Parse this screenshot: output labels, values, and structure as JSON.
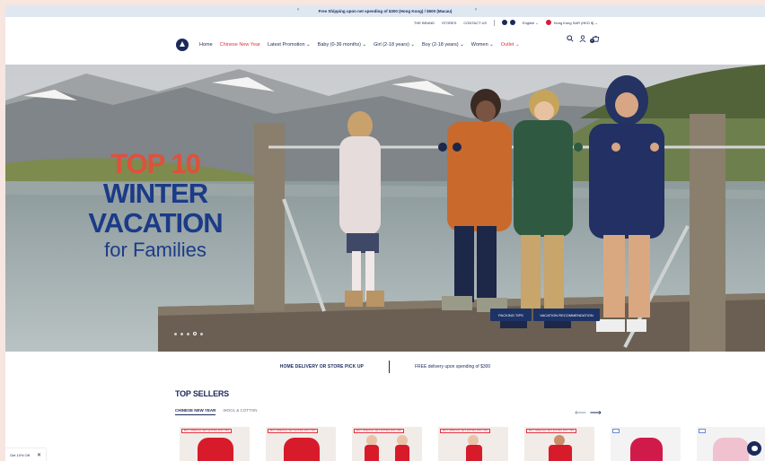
{
  "announcement": {
    "text": "Free Shipping upon net spending of $300 (Hong Kong) / $500 (Macau)",
    "prev_icon": "chevron-left-icon",
    "next_icon": "chevron-right-icon"
  },
  "utility_bar": {
    "links": [
      "THE BRAND",
      "STORES",
      "CONTACT US"
    ],
    "social_icons": [
      "facebook-icon",
      "instagram-icon"
    ],
    "language": "English",
    "region": "Hong Kong SAR (HKD $)"
  },
  "nav": {
    "logo_icon": "boat-logo-icon",
    "items": [
      {
        "label": "Home",
        "dropdown": false,
        "color": "#1b2a5a"
      },
      {
        "label": "Chinese New Year",
        "dropdown": false,
        "color": "#e03140"
      },
      {
        "label": "Latest Promotion",
        "dropdown": true,
        "color": "#1b2a5a"
      },
      {
        "label": "Baby (0-36 months)",
        "dropdown": true,
        "color": "#1b2a5a"
      },
      {
        "label": "Girl (2-18 years)",
        "dropdown": true,
        "color": "#1b2a5a"
      },
      {
        "label": "Boy (2-18 years)",
        "dropdown": true,
        "color": "#1b2a5a"
      },
      {
        "label": "Women",
        "dropdown": true,
        "color": "#1b2a5a"
      },
      {
        "label": "Outlet",
        "dropdown": true,
        "color": "#e03140"
      }
    ],
    "icons": [
      "search-icon",
      "account-icon",
      "cart-icon"
    ],
    "cart_count": "0"
  },
  "hero": {
    "headline_line1": "TOP 10",
    "headline_line2": "WINTER",
    "headline_line3": "VACATION",
    "headline_line4": "for Families",
    "buttons": [
      "PACKING TIPS",
      "VACATION RECOMMENDATION"
    ],
    "slide_count": 5,
    "active_slide": 4
  },
  "delivery": {
    "left": "HOME DELIVERY OR STORE PICK UP",
    "right": "FREE delivery upon spending of $300"
  },
  "top_sellers": {
    "title": "TOP SELLERS",
    "tabs": [
      "CHINESE NEW YEAR",
      "WOOL & COTTON"
    ],
    "active_tab": 0,
    "badge_text": "BUY SPECIAL SET EXTRA 20% OFF"
  },
  "coupon": {
    "label": "Get 10% Off",
    "close_icon": "close-icon"
  },
  "chat_icon": "chat-icon",
  "colors": {
    "navy": "#1b2a5a",
    "accent_red": "#e03140",
    "announcement_bg": "#dfe7f1"
  }
}
